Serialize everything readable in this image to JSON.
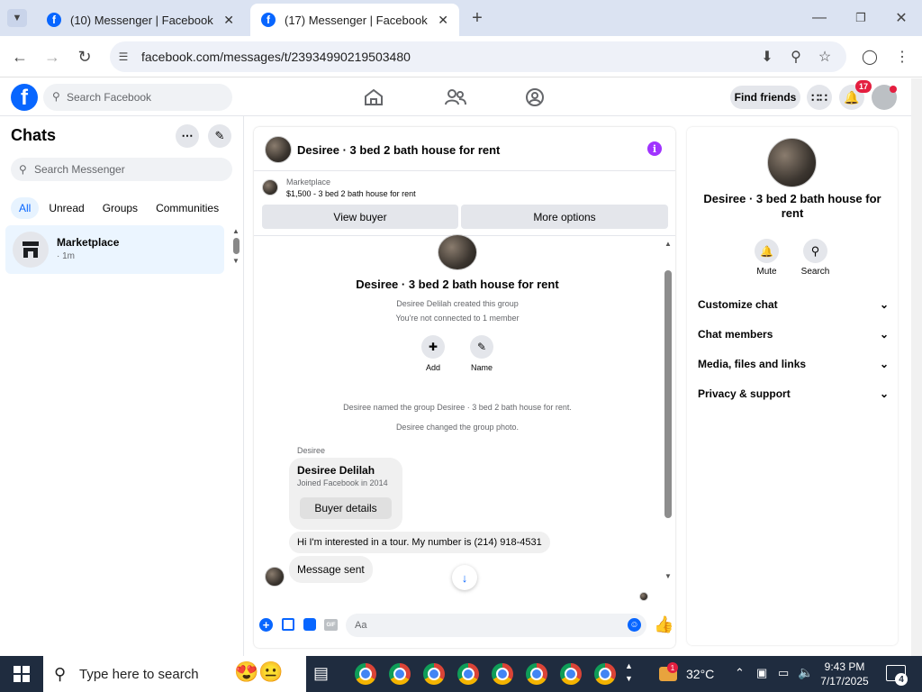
{
  "browser": {
    "tabs": [
      {
        "title": "(10) Messenger | Facebook",
        "active": false
      },
      {
        "title": "(17) Messenger | Facebook",
        "active": true
      }
    ],
    "url": "facebook.com/messages/t/23934990219503480"
  },
  "fb_header": {
    "search_placeholder": "Search Facebook",
    "find_friends": "Find friends",
    "notification_count": "17"
  },
  "sidebar": {
    "title": "Chats",
    "search_placeholder": "Search Messenger",
    "filters": [
      "All",
      "Unread",
      "Groups",
      "Communities"
    ],
    "chats": [
      {
        "name": "Marketplace",
        "time": "· 1m"
      }
    ]
  },
  "chat": {
    "title": "Desiree · 3 bed 2 bath house for rent",
    "listing": {
      "source": "Marketplace",
      "summary": "$1,500 - 3 bed 2 bath house for rent",
      "view_buyer": "View buyer",
      "more_options": "More options"
    },
    "group": {
      "name": "Desiree · 3 bed 2 bath house for rent",
      "created": "Desiree Delilah created this group",
      "connection": "You're not connected to 1 member",
      "add_label": "Add",
      "name_label": "Name"
    },
    "system_messages": [
      "Desiree named the group Desiree · 3 bed 2 bath house for rent.",
      "Desiree changed the group photo."
    ],
    "buyer_card": {
      "sender": "Desiree",
      "name": "Desiree Delilah",
      "joined": "Joined Facebook in 2014",
      "button": "Buyer details"
    },
    "messages": [
      "Hi I'm interested in a tour. My number is (214) 918-4531",
      "Message sent"
    ],
    "composer_placeholder": "Aa"
  },
  "details": {
    "title": "Desiree · 3 bed 2 bath house for rent",
    "actions": [
      "Mute",
      "Search"
    ],
    "sections": [
      "Customize chat",
      "Chat members",
      "Media, files and links",
      "Privacy & support"
    ]
  },
  "taskbar": {
    "search_placeholder": "Type here to search",
    "temperature": "32°C",
    "weather_badge": "1",
    "time": "9:43 PM",
    "date": "7/17/2025",
    "notifications": "4"
  },
  "colors": {
    "brand": "#0866ff",
    "messenger_accent": "#a033ff",
    "taskbar": "#1f2c3f"
  }
}
